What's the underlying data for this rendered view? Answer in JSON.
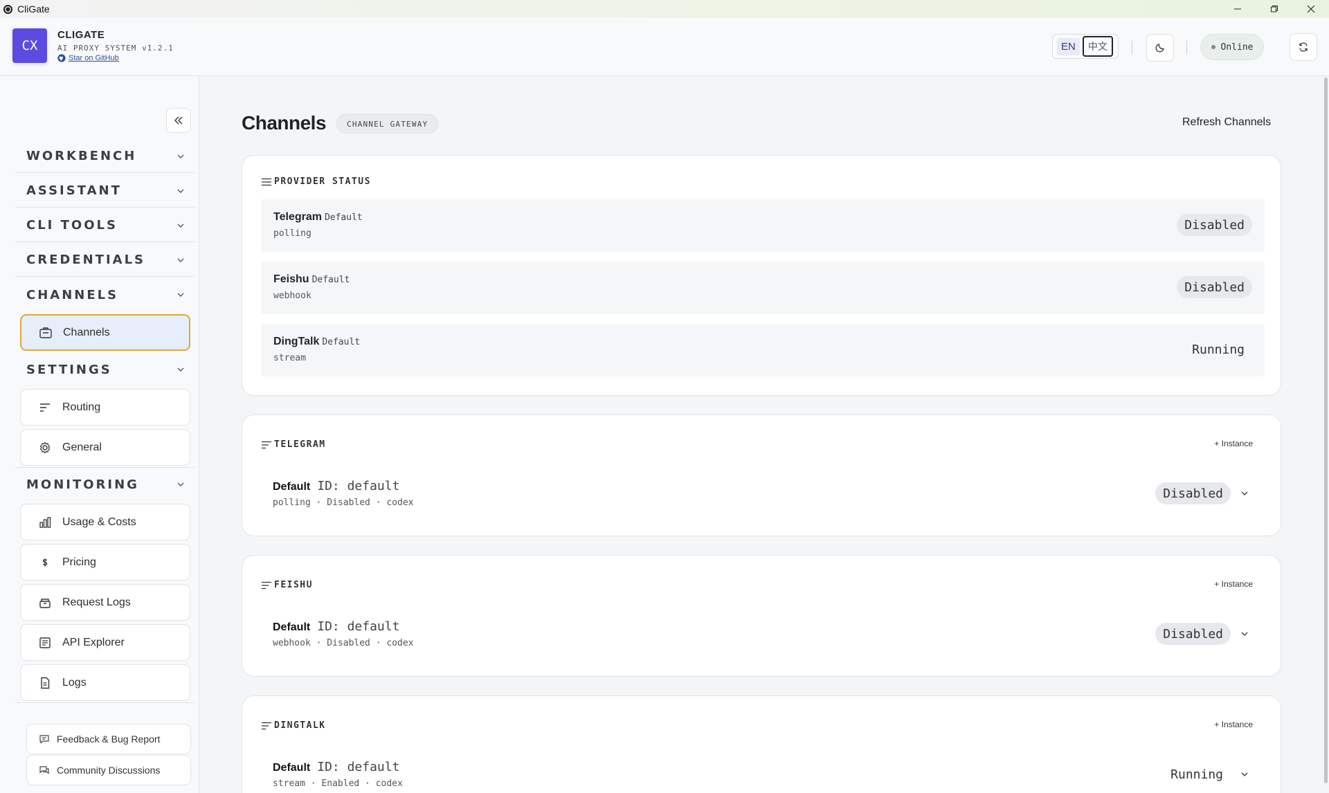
{
  "window": {
    "title": "CliGate"
  },
  "header": {
    "logo_text": "CX",
    "brand_name": "CLIGATE",
    "brand_sub": "AI PROXY SYSTEM v1.2.1",
    "github_link": "Star on GitHub",
    "lang_en": "EN",
    "lang_zh": "中文",
    "status": "Online"
  },
  "sidebar": {
    "sections": {
      "workbench": "WORKBENCH",
      "assistant": "ASSISTANT",
      "cli_tools": "CLI TOOLS",
      "credentials": "CREDENTIALS",
      "channels": "CHANNELS",
      "settings": "SETTINGS",
      "monitoring": "MONITORING"
    },
    "items": {
      "channels": "Channels",
      "routing": "Routing",
      "general": "General",
      "usage": "Usage & Costs",
      "pricing": "Pricing",
      "request_logs": "Request Logs",
      "api_explorer": "API Explorer",
      "logs": "Logs"
    },
    "footer": {
      "feedback": "Feedback & Bug Report",
      "community": "Community Discussions"
    }
  },
  "main": {
    "title": "Channels",
    "badge": "CHANNEL GATEWAY",
    "refresh": "Refresh Channels",
    "provider_status": {
      "heading": "PROVIDER STATUS",
      "rows": [
        {
          "name": "Telegram",
          "tag": "Default",
          "mode": "polling",
          "status": "Disabled"
        },
        {
          "name": "Feishu",
          "tag": "Default",
          "mode": "webhook",
          "status": "Disabled"
        },
        {
          "name": "DingTalk",
          "tag": "Default",
          "mode": "stream",
          "status": "Running"
        }
      ]
    },
    "add_instance": "+ Instance",
    "providers": [
      {
        "heading": "TELEGRAM",
        "instance_name": "Default",
        "instance_id": "ID: default",
        "meta": "polling · Disabled · codex",
        "status": "Disabled"
      },
      {
        "heading": "FEISHU",
        "instance_name": "Default",
        "instance_id": "ID: default",
        "meta": "webhook · Disabled · codex",
        "status": "Disabled"
      },
      {
        "heading": "DINGTALK",
        "instance_name": "Default",
        "instance_id": "ID: default",
        "meta": "stream · Enabled · codex",
        "status": "Running"
      }
    ]
  }
}
